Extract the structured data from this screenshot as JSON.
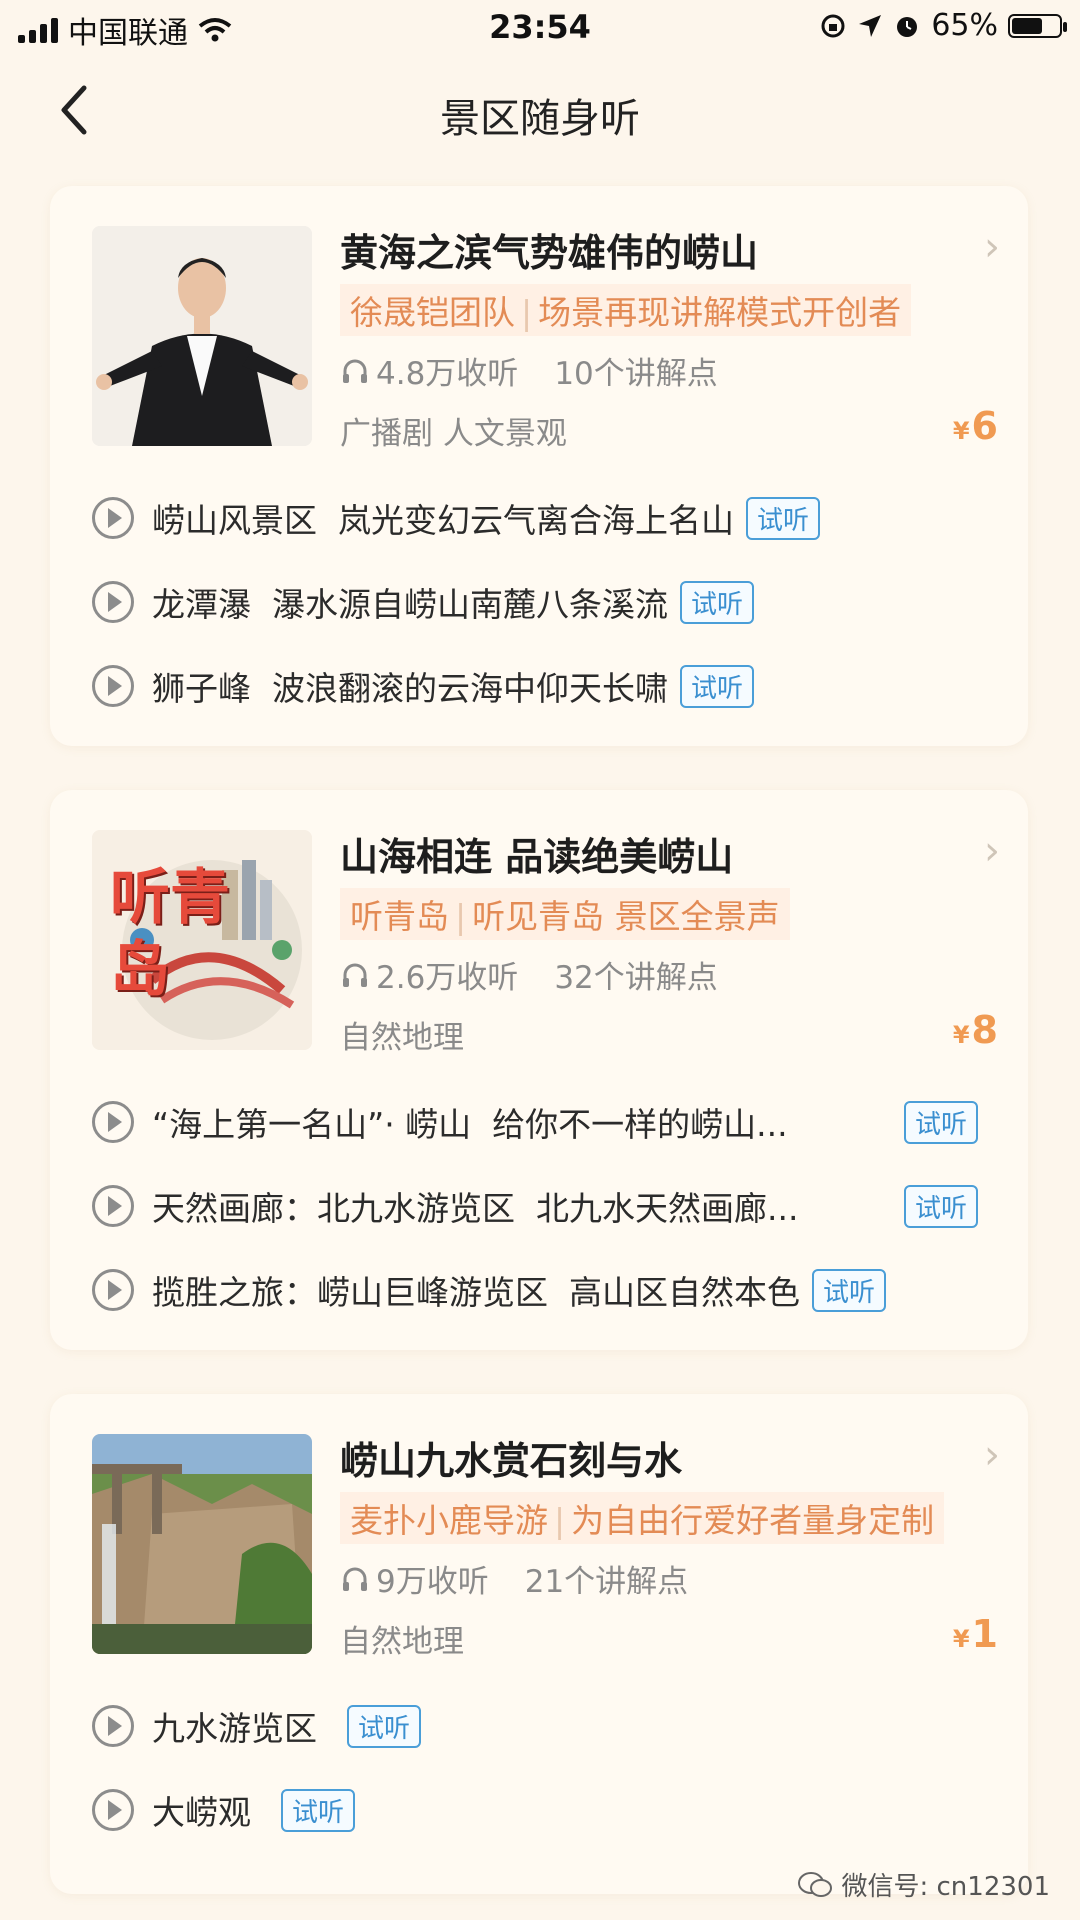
{
  "status_bar": {
    "carrier": "中国联通",
    "time": "23:54",
    "battery": "65%",
    "battery_level": 0.65
  },
  "nav": {
    "title": "景区随身听"
  },
  "cards": [
    {
      "title": "黄海之滨气势雄伟的崂山",
      "author": "徐晟铠团队",
      "author_desc": "场景再现讲解模式开创者",
      "listens": "4.8万收听",
      "points": "10个讲解点",
      "tags": "广播剧  人文景观",
      "currency": "¥",
      "price": "6",
      "tracks": [
        {
          "name": "崂山风景区",
          "desc": "岚光变幻云气离合海上名山",
          "trial": "试听"
        },
        {
          "name": "龙潭瀑",
          "desc": "瀑水源自崂山南麓八条溪流",
          "trial": "试听"
        },
        {
          "name": "狮子峰",
          "desc": "波浪翻滚的云海中仰天长啸",
          "trial": "试听"
        }
      ]
    },
    {
      "title": "山海相连 品读绝美崂山",
      "author": "听青岛",
      "author_desc": "听见青岛 景区全景声",
      "cover_text": "听青岛",
      "listens": "2.6万收听",
      "points": "32个讲解点",
      "tags": "自然地理",
      "currency": "¥",
      "price": "8",
      "tracks": [
        {
          "name": "“海上第一名山”· 崂山",
          "desc": "给你不一样的崂山...",
          "trial": "试听"
        },
        {
          "name": "天然画廊：北九水游览区",
          "desc": "北九水天然画廊...",
          "trial": "试听"
        },
        {
          "name": "揽胜之旅：崂山巨峰游览区",
          "desc": "高山区自然本色",
          "trial": "试听"
        }
      ]
    },
    {
      "title": "崂山九水赏石刻与水",
      "author": "麦扑小鹿导游",
      "author_desc": "为自由行爱好者量身定制",
      "listens": "9万收听",
      "points": "21个讲解点",
      "tags": "自然地理",
      "currency": "¥",
      "price": "1",
      "tracks": [
        {
          "name": "九水游览区",
          "desc": "",
          "trial": "试听"
        },
        {
          "name": "大崂观",
          "desc": "",
          "trial": "试听"
        }
      ]
    }
  ],
  "watermark": "微信号: cn12301"
}
